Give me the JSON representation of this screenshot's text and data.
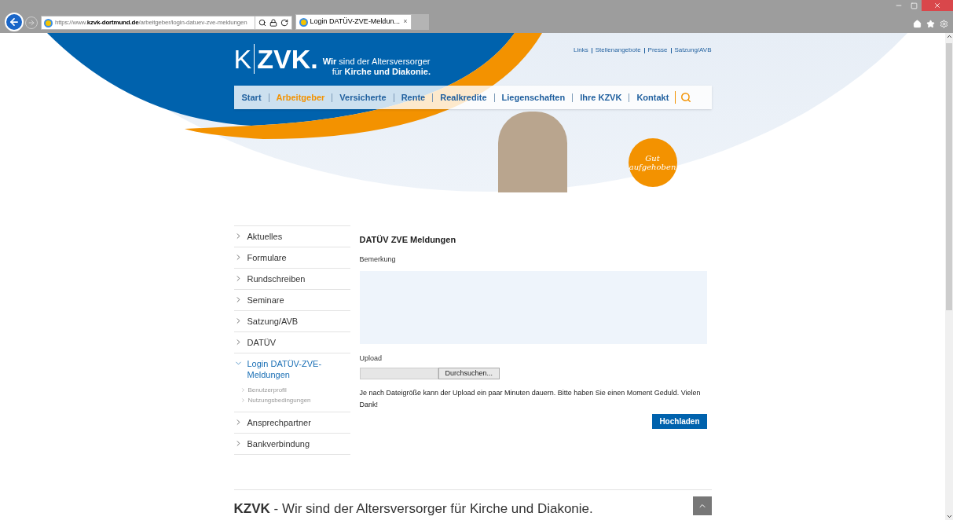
{
  "browser": {
    "url": {
      "scheme": "https://www.",
      "domain": "kzvk-dortmund.de",
      "path": "/arbeitgeber/login-datuev-zve-meldungen"
    },
    "tab": {
      "title": "Login DATÜV-ZVE-Meldun...",
      "close": "×"
    }
  },
  "header": {
    "logo": {
      "k": "K",
      "zvk": "ZVK."
    },
    "tagline": [
      "**Wir** sind der Altersversorger",
      "für **Kirche und Diakonie.**"
    ],
    "top_links": [
      "Links",
      "Stellenangebote",
      "Presse",
      "Satzung/AVB"
    ],
    "nav": [
      {
        "label": "Start",
        "selected": false
      },
      {
        "label": "Arbeitgeber",
        "selected": true
      },
      {
        "label": "Versicherte",
        "selected": false
      },
      {
        "label": "Rente",
        "selected": false
      },
      {
        "label": "Realkredite",
        "selected": false
      },
      {
        "label": "Liegenschaften",
        "selected": false
      },
      {
        "label": "Ihre KZVK",
        "selected": false
      },
      {
        "label": "Kontakt",
        "selected": false
      }
    ],
    "badge": [
      "Gut",
      "aufgehoben"
    ]
  },
  "sidebar": [
    {
      "label": "Aktuelles",
      "expanded": false
    },
    {
      "label": "Formulare",
      "expanded": false
    },
    {
      "label": "Rundschreiben",
      "expanded": false
    },
    {
      "label": "Seminare",
      "expanded": false
    },
    {
      "label": "Satzung/AVB",
      "expanded": false
    },
    {
      "label": "DATÜV",
      "expanded": false
    },
    {
      "label": "Login DATÜV-ZVE-Meldungen",
      "expanded": true,
      "children": [
        {
          "label": "Benutzerprofil"
        },
        {
          "label": "Nutzungsbedingungen"
        }
      ]
    },
    {
      "label": "Ansprechpartner",
      "expanded": false
    },
    {
      "label": "Bankverbindung",
      "expanded": false
    }
  ],
  "form": {
    "title": "DATÜV ZVE Meldungen",
    "remark_label": "Bemerkung",
    "upload_label": "Upload",
    "browse_button": "Durchsuchen...",
    "note": "Je nach Dateigröße kann der Upload ein paar Minuten dauern. Bitte haben Sie einen Moment Geduld. Vielen Dank!",
    "submit": "Hochladen"
  },
  "footer": {
    "text": "**KZVK** - Wir sind der Altersversorger für Kirche und Diakonie."
  }
}
